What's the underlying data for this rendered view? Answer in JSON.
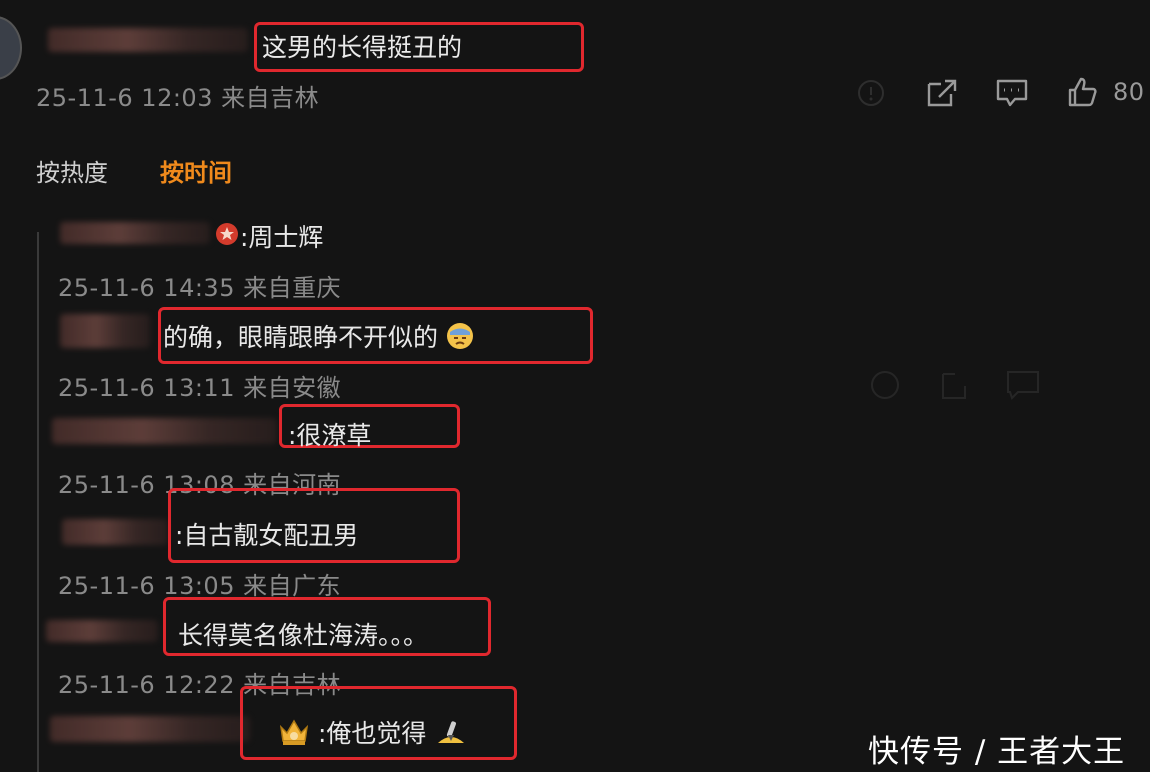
{
  "comment": {
    "text": "这男的长得挺丑的",
    "meta": "25-11-6 12:03 来自吉林",
    "like_count": "80"
  },
  "sort_tabs": {
    "by_hot": "按热度",
    "by_time": "按时间"
  },
  "replies": [
    {
      "text": ":周士辉",
      "meta": "25-11-6 14:35 来自重庆"
    },
    {
      "text": "的确，眼睛跟睁不开似的",
      "meta": "25-11-6 13:11 来自安徽"
    },
    {
      "text": ":很潦草",
      "meta": "25-11-6 13:08 来自河南"
    },
    {
      "text": ":自古靓女配丑男",
      "meta": "25-11-6 13:05 来自广东"
    },
    {
      "text": "长得莫名像杜海涛。。。",
      "meta": "25-11-6 12:22 来自吉林"
    },
    {
      "text": ":俺也觉得"
    }
  ],
  "icons": [
    "info-icon",
    "share-icon",
    "comment-icon",
    "like-icon",
    "badge-icon",
    "tired-face-emoji",
    "crown-emoji",
    "rocket-emoji"
  ],
  "colors": {
    "background": "#141414",
    "highlight": "#e0282e",
    "active_tab": "#f08a1c"
  },
  "watermark": "快传号 / 王者大王"
}
